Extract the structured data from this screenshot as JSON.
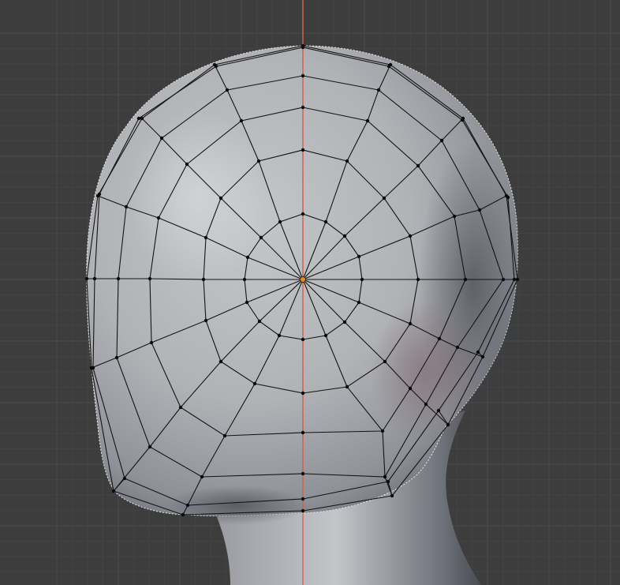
{
  "viewport": {
    "colors": {
      "background": "#3d3d3d",
      "grid_minor": "#454545",
      "grid_major": "#4a4a4a",
      "axis_line": "#d9644f",
      "wire": "#141414",
      "vertex": "#0a0a0a",
      "active_vertex": "#e38e1b",
      "surface_light": "#c9cacd",
      "surface_mid": "#a4a6ab",
      "surface_dark": "#5e6068",
      "surface_shadow": "#7c5c66"
    },
    "icons": {
      "origin": "mesh-origin-icon"
    }
  }
}
